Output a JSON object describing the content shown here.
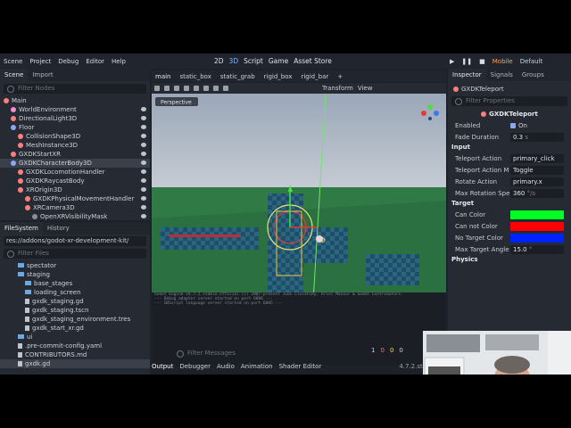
{
  "menu": {
    "scene": "Scene",
    "project": "Project",
    "debug": "Debug",
    "editor": "Editor",
    "help": "Help"
  },
  "modes": {
    "m2d": "2D",
    "m3d": "3D",
    "script": "Script",
    "game": "Game",
    "asset": "Asset Store"
  },
  "renderer": {
    "mobile": "Mobile",
    "default": "Default"
  },
  "scene_tabs": {
    "scene": "Scene",
    "import": "Import",
    "filter": "Filter Nodes"
  },
  "tree": [
    "Main",
    "WorldEnvironment",
    "DirectionalLight3D",
    "Floor",
    "CollisionShape3D",
    "MeshInstance3D",
    "GXDKStartXR",
    "GXDKCharacterBody3D",
    "GXDKLocomotionHandler",
    "GXDKRaycastBody",
    "XROrigin3D",
    "GXDKPhysicalMovementHandler",
    "XRCamera3D",
    "OpenXRVisibilityMask"
  ],
  "fs": {
    "title": "FileSystem",
    "history": "History",
    "path": "res://addons/godot-xr-development-kit/",
    "filter": "Filter Files",
    "items": [
      "spectator",
      "staging",
      "base_stages",
      "loading_screen",
      "gxdk_staging.gd",
      "gxdk_staging.tscn",
      "gxdk_staging_environment.tres",
      "gxdk_start_xr.gd",
      "ui",
      ".pre-commit-config.yaml",
      "CONTRIBUTORS.md",
      "gxdk.gd"
    ]
  },
  "doc_tabs": [
    "main",
    "static_box",
    "static_grab",
    "rigid_box",
    "rigid_bar"
  ],
  "viewport": {
    "perspective": "Perspective",
    "transform": "Transform",
    "view": "View"
  },
  "inspector": {
    "title": "Inspector",
    "signals": "Signals",
    "groups": "Groups",
    "node": "GXDKTeleport",
    "filter": "Filter Properties",
    "header": "GXDKTeleport",
    "enabled_label": "Enabled",
    "enabled_value": "On",
    "fade_label": "Fade Duration",
    "fade_value": "0.3",
    "fade_unit": "s",
    "input": "Input",
    "ta_label": "Teleport Action",
    "ta_value": "primary_click",
    "tam_label": "Teleport Action M",
    "tam_value": "Toggle",
    "ra_label": "Rotate Action",
    "ra_value": "primary.x",
    "mrs_label": "Max Rotation Spe",
    "mrs_value": "360",
    "mrs_unit": "°/s",
    "target": "Target",
    "cc_label": "Can Color",
    "cnc_label": "Can not Color",
    "ntc_label": "No Target Color",
    "mta_label": "Max Target Angle",
    "mta_value": "15.0",
    "mta_unit": "°",
    "physics": "Physics"
  },
  "colors": {
    "can": "#00ff22",
    "cannot": "#ff0000",
    "notarget": "#0022ff"
  },
  "console": {
    "l1": "Godot Engine v4.7.2.stable.official (c) 2007-present Juan Linietsky, Ariel Manzur & Godot Contributors.",
    "l2": "--- Debug adapter server started on port 6006 ---",
    "l3": "--- GDScript language server started on port 6005 ---",
    "filter": "Filter Messages",
    "c1": "1",
    "c2": "0",
    "c3": "0",
    "c4": "0"
  },
  "bottom_tabs": {
    "output": "Output",
    "debugger": "Debugger",
    "audio": "Audio",
    "animation": "Animation",
    "shader": "Shader Editor",
    "version": "4.7.2.stable"
  }
}
